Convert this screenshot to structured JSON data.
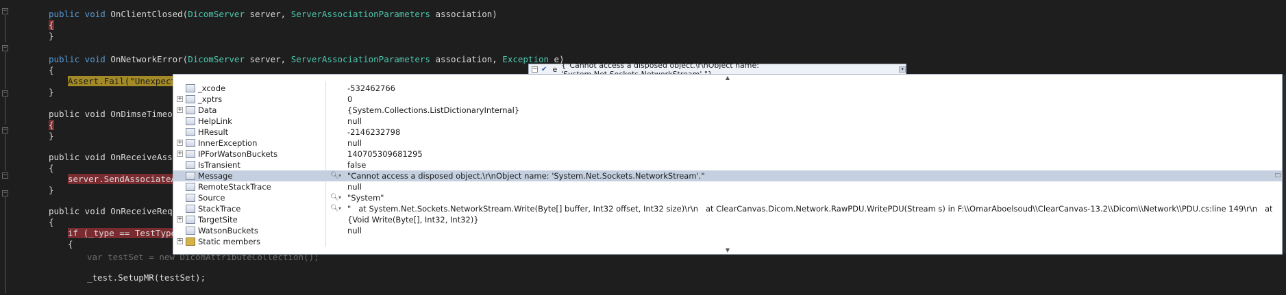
{
  "code": {
    "lines": [
      {
        "kw": "public void ",
        "method": "OnClientClosed(",
        "t1": "DicomServer",
        "p1": " server, ",
        "t2": "ServerAssociationParameters",
        "p2": " association)"
      },
      {
        "brace": "{"
      },
      {
        "brace": "}"
      },
      {
        "kw": "public void ",
        "method": "OnNetworkError(",
        "t1": "DicomServer",
        "p1": " server, ",
        "t2": "ServerAssociationParameters",
        "p2": " association, ",
        "t3": "Exception",
        "p3": " e)"
      },
      {
        "brace": "{"
      },
      {
        "stmt": "Assert.Fail(\"Unexpecte"
      },
      {
        "brace": "}"
      },
      {
        "method_only": "public void OnDimseTimeout"
      },
      {
        "brace": "{"
      },
      {
        "brace": "}"
      },
      {
        "method_only": "public void OnReceiveAssoc"
      },
      {
        "brace": "{"
      },
      {
        "stmt": "server.SendAssociateAc"
      },
      {
        "brace": "}"
      },
      {
        "method_only": "public void OnReceiveReque"
      },
      {
        "brace": "{"
      },
      {
        "stmt": "if (_type == TestTypes"
      },
      {
        "brace": "{"
      },
      {
        "stmt": "var testSet = new DicomAttributeCollection();"
      },
      {
        "stmt": "_test.SetupMR(testSet);"
      }
    ]
  },
  "datatip": {
    "var_name": "e",
    "var_value": "{\"Cannot access a disposed object.\\r\\nObject name: 'System.Net.Sockets.NetworkStream'.\"}",
    "rows": [
      {
        "name": "_xcode",
        "value": "-532462766",
        "icon": "lock-field-icon",
        "expandable": false
      },
      {
        "name": "_xptrs",
        "value": "0",
        "icon": "lock-field-icon",
        "expandable": true
      },
      {
        "name": "Data",
        "value": "{System.Collections.ListDictionaryInternal}",
        "icon": "property-icon",
        "expandable": true
      },
      {
        "name": "HelpLink",
        "value": "null",
        "icon": "property-icon",
        "expandable": false
      },
      {
        "name": "HResult",
        "value": "-2146232798",
        "icon": "property-icon",
        "expandable": false
      },
      {
        "name": "InnerException",
        "value": "null",
        "icon": "property-icon",
        "expandable": true
      },
      {
        "name": "IPForWatsonBuckets",
        "value": "140705309681295",
        "icon": "property-icon",
        "expandable": true
      },
      {
        "name": "IsTransient",
        "value": "false",
        "icon": "property-icon",
        "expandable": false
      },
      {
        "name": "Message",
        "value": "\"Cannot access a disposed object.\\r\\nObject name: 'System.Net.Sockets.NetworkStream'.\"",
        "icon": "property-icon",
        "expandable": false,
        "selected": true,
        "visualizer": true
      },
      {
        "name": "RemoteStackTrace",
        "value": "null",
        "icon": "property-icon",
        "expandable": false
      },
      {
        "name": "Source",
        "value": "\"System\"",
        "icon": "property-icon",
        "expandable": false,
        "visualizer": true
      },
      {
        "name": "StackTrace",
        "value": "\"   at System.Net.Sockets.NetworkStream.Write(Byte[] buffer, Int32 offset, Int32 size)\\r\\n   at ClearCanvas.Dicom.Network.RawPDU.WritePDU(Stream s) in F:\\\\OmarAboelsoud\\\\ClearCanvas-13.2\\\\Dicom\\\\Network\\\\PDU.cs:line 149\\r\\n   at ClearCanvas.Dicom.N...",
        "icon": "property-icon",
        "expandable": false,
        "visualizer": true
      },
      {
        "name": "TargetSite",
        "value": "{Void Write(Byte[], Int32, Int32)}",
        "icon": "property-icon",
        "expandable": true
      },
      {
        "name": "WatsonBuckets",
        "value": "null",
        "icon": "property-icon",
        "expandable": false
      },
      {
        "name": "Static members",
        "value": "",
        "icon": "static-members-icon",
        "expandable": true
      }
    ]
  }
}
